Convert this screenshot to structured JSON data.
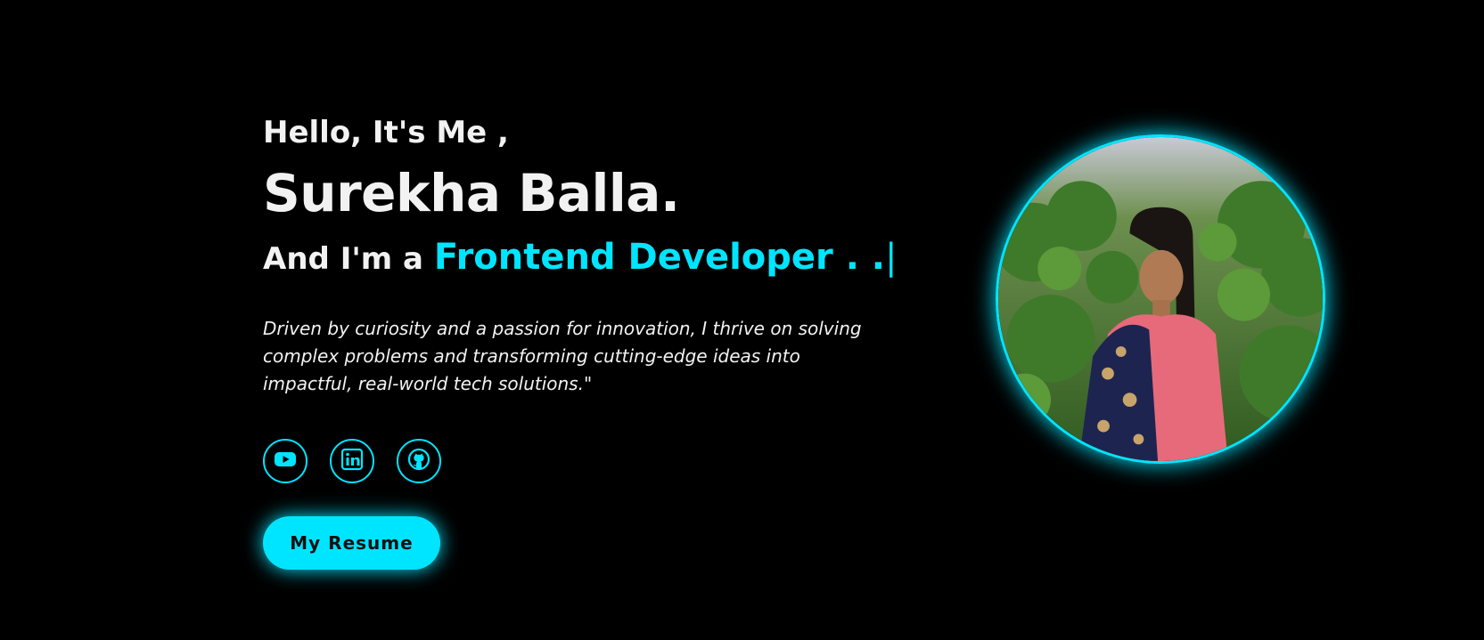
{
  "hero": {
    "greeting": "Hello, It's Me ,",
    "name": "Surekha Balla.",
    "role_prefix": "And I'm a",
    "role": "Frontend Developer . .",
    "cursor": "|",
    "tagline": "Driven by curiosity and a passion for innovation, I thrive on solving complex problems and transforming cutting-edge ideas into impactful, real-world tech solutions.\""
  },
  "socials": [
    {
      "icon": "youtube-icon"
    },
    {
      "icon": "linkedin-icon"
    },
    {
      "icon": "github-icon"
    }
  ],
  "resume_button": {
    "label": "My Resume"
  },
  "avatar": {
    "description_icon": "profile-photo"
  },
  "colors": {
    "background": "#000000",
    "accent": "#00e5ff",
    "text": "#f2f2f2",
    "button_text": "#111111"
  }
}
